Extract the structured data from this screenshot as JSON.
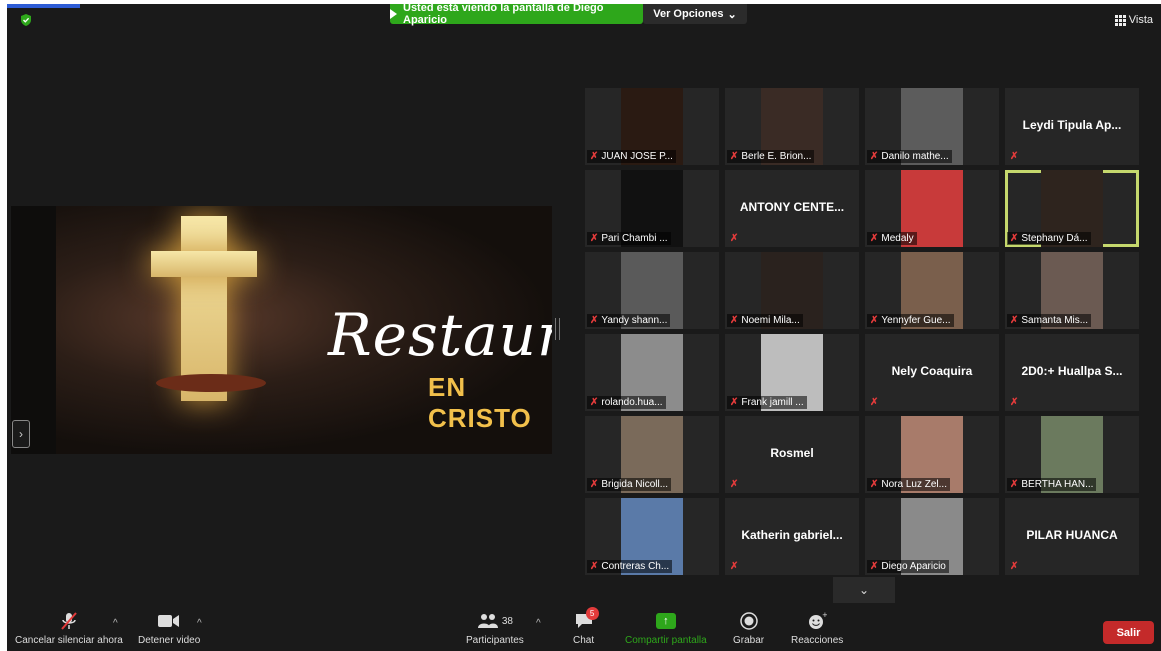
{
  "top": {
    "banner_text": "Usted está viendo la pantalla de Diego Aparicio",
    "view_options": "Ver Opciones",
    "vista": "Vista"
  },
  "shared": {
    "title": "Restaurad",
    "subtitle": "EN CRISTO"
  },
  "participants": [
    {
      "name": "JUAN JOSE P...",
      "type": "video",
      "bg": "#2a1a12"
    },
    {
      "name": "Berle E. Brion...",
      "type": "video",
      "bg": "#3a2b25"
    },
    {
      "name": "Danilo mathe...",
      "type": "video",
      "bg": "#5c5c5c"
    },
    {
      "name": "Leydi Tipula Ap...",
      "type": "name"
    },
    {
      "name": "Pari Chambi ...",
      "type": "video",
      "bg": "#111111"
    },
    {
      "name": "ANTONY CENTE...",
      "type": "name"
    },
    {
      "name": "Medaly",
      "type": "video",
      "bg": "#c83a3a"
    },
    {
      "name": "Stephany Dá...",
      "type": "video",
      "bg": "#2e241e",
      "active": true
    },
    {
      "name": "Yandy shann...",
      "type": "video",
      "bg": "#5a5a5a"
    },
    {
      "name": "Noemi Mila...",
      "type": "video",
      "bg": "#2a221e"
    },
    {
      "name": "Yennyfer Gue...",
      "type": "video",
      "bg": "#7a5f4c"
    },
    {
      "name": "Samanta Mis...",
      "type": "video",
      "bg": "#6b5a52"
    },
    {
      "name": "rolando.hua...",
      "type": "video",
      "bg": "#8c8c8c"
    },
    {
      "name": "Frank jamill ...",
      "type": "video",
      "bg": "#bdbdbd"
    },
    {
      "name": "Nely Coaquira",
      "type": "name"
    },
    {
      "name": "2D0:+ Huallpa S...",
      "type": "name"
    },
    {
      "name": "Brigida Nicoll...",
      "type": "video",
      "bg": "#7a6a5a"
    },
    {
      "name": "Rosmel",
      "type": "name"
    },
    {
      "name": "Nora Luz Zel...",
      "type": "video",
      "bg": "#a87b6a"
    },
    {
      "name": "BERTHA HAN...",
      "type": "video",
      "bg": "#6b7a5e"
    },
    {
      "name": "Contreras Ch...",
      "type": "video",
      "bg": "#5a7aa8"
    },
    {
      "name": "Katherin gabriel...",
      "type": "name"
    },
    {
      "name": "Diego Aparicio",
      "type": "video",
      "bg": "#8a8a8a"
    },
    {
      "name": "PILAR HUANCA",
      "type": "name"
    }
  ],
  "toolbar": {
    "mute": "Cancelar silenciar ahora",
    "video": "Detener video",
    "participants": "Participantes",
    "participants_count": "38",
    "chat": "Chat",
    "chat_badge": "5",
    "share": "Compartir pantalla",
    "record": "Grabar",
    "reactions": "Reacciones",
    "leave": "Salir"
  },
  "colors": {
    "banner": "#2ea71b",
    "leave": "#c42a2a",
    "active_speaker": "#c5d86d",
    "mic_off": "#e23b3b"
  }
}
